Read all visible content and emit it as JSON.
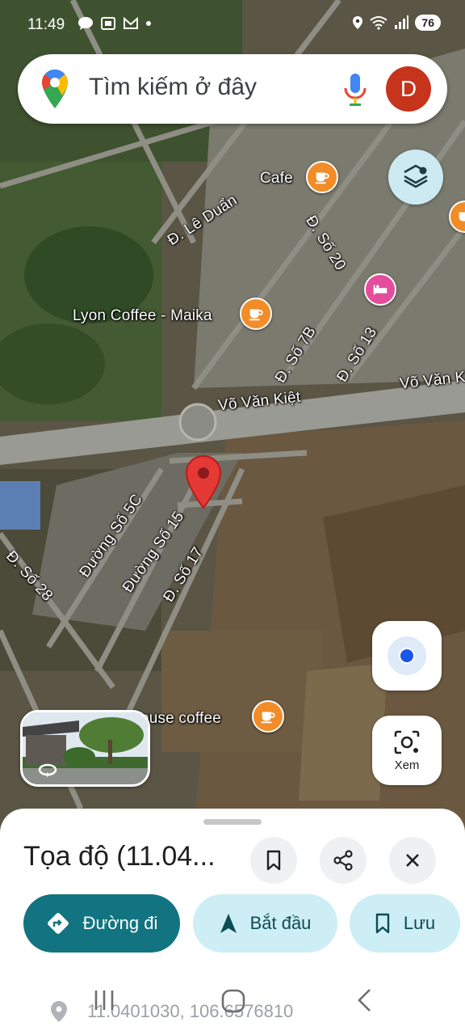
{
  "status_bar": {
    "time": "11:49",
    "battery": "76"
  },
  "search": {
    "placeholder": "Tìm kiếm ở đây",
    "avatar_letter": "D"
  },
  "map": {
    "street_labels": [
      {
        "id": "le-duan",
        "text": "Đ. Lê Duẩn"
      },
      {
        "id": "so-20",
        "text": "Đ. Số 20"
      },
      {
        "id": "so-7b",
        "text": "Đ. Số 7B"
      },
      {
        "id": "so-13",
        "text": "Đ. Số 13"
      },
      {
        "id": "vo-van-kiet-1",
        "text": "Võ Văn Kiệt"
      },
      {
        "id": "vo-van-kiet-2",
        "text": "Võ Văn Ki"
      },
      {
        "id": "so-5c",
        "text": "Đường Số 5C"
      },
      {
        "id": "so-15",
        "text": "Đường Số 15"
      },
      {
        "id": "so-17",
        "text": "Đ. Số 17"
      },
      {
        "id": "so-28",
        "text": "Đ. Số 28"
      }
    ],
    "poi_labels": {
      "cafe": "Cafe",
      "lyon": "Lyon Coffee - Maika",
      "house": "House coffee"
    }
  },
  "controls": {
    "lens_label": "Xem"
  },
  "sheet": {
    "title": "Tọa độ (11.04...",
    "directions_label": "Đường đi",
    "start_label": "Bắt đầu",
    "save_label": "Lưu",
    "coordinates": "11.0401030, 106.6576810"
  },
  "colors": {
    "primary": "#127480",
    "secondary": "#cdeef4",
    "poi": "#f28c28",
    "pin": "#e53935"
  }
}
